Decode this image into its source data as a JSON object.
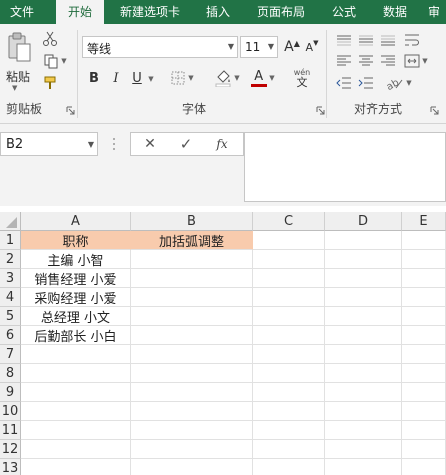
{
  "tabs": [
    "文件",
    "开始",
    "新建选项卡",
    "插入",
    "页面布局",
    "公式",
    "数据",
    "审"
  ],
  "active_tab": 1,
  "colors": {
    "brand": "#217346",
    "header_fill": "#f8cbad",
    "font_color_bar": "#c00000"
  },
  "ribbon": {
    "clipboard": {
      "label": "剪贴板",
      "paste_label": "粘贴"
    },
    "font": {
      "label": "字体",
      "font_name": "等线",
      "font_size": "11",
      "bold": "B",
      "italic": "I",
      "underline": "U",
      "grow": "A",
      "shrink": "A",
      "color_letter": "A",
      "phonetic_top": "wén",
      "phonetic_bottom": "文"
    },
    "alignment": {
      "label": "对齐方式"
    }
  },
  "formula_bar": {
    "name_box": "B2",
    "cancel_glyph": "✕",
    "enter_glyph": "✓",
    "fx_label": "fx",
    "formula": ""
  },
  "grid": {
    "columns": [
      "A",
      "B",
      "C",
      "D",
      "E"
    ],
    "rows": [
      "1",
      "2",
      "3",
      "4",
      "5",
      "6",
      "7",
      "8",
      "9",
      "10",
      "11",
      "12",
      "13"
    ],
    "cells": [
      [
        "职称",
        "加括弧调整"
      ],
      [
        "主编 小智",
        ""
      ],
      [
        "销售经理 小爱",
        ""
      ],
      [
        "采购经理 小爱",
        ""
      ],
      [
        "总经理 小文",
        ""
      ],
      [
        "后勤部长 小白",
        ""
      ]
    ]
  }
}
